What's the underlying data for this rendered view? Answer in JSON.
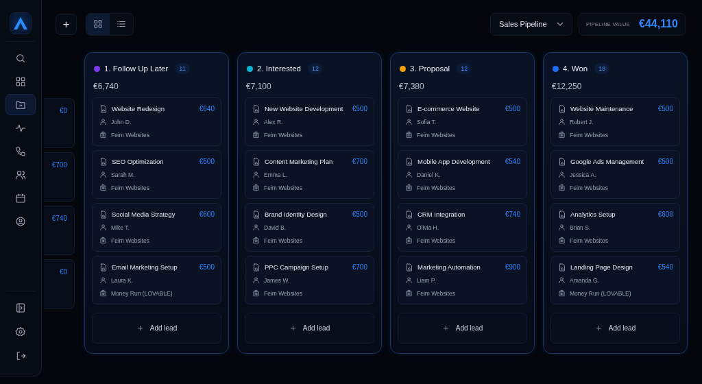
{
  "sidebar": {
    "nav": [
      {
        "selected": false
      },
      {
        "selected": false
      },
      {
        "selected": true
      },
      {
        "selected": false
      },
      {
        "selected": false
      },
      {
        "selected": false
      },
      {
        "selected": false
      },
      {
        "selected": false
      }
    ],
    "footer": [
      {
        "selected": false
      },
      {
        "selected": false
      },
      {
        "selected": false
      }
    ]
  },
  "toolbar": {
    "add_button": "+",
    "views": [
      {
        "kind": "grid",
        "selected": true
      },
      {
        "kind": "list",
        "selected": false
      }
    ],
    "pipeline_select": "Sales Pipeline",
    "pipeline_value": {
      "label": "PIPELINE VALUE",
      "amount": "€44,110"
    }
  },
  "partial_column": {
    "amounts": [
      "€0",
      "€700",
      "€740",
      "€0"
    ]
  },
  "columns": [
    {
      "name": "1. Follow Up Later",
      "color": "#7c3aed",
      "count": "11",
      "total": "€6,740",
      "add_label": "Add lead",
      "leads": [
        {
          "title": "Website Redesign",
          "amount": "€640",
          "contact": "John D.",
          "company": "Feim Websites"
        },
        {
          "title": "SEO Optimization",
          "amount": "€500",
          "contact": "Sarah M.",
          "company": "Feim Websites"
        },
        {
          "title": "Social Media Strategy",
          "amount": "€600",
          "contact": "Mike T.",
          "company": "Feim Websites"
        },
        {
          "title": "Email Marketing Setup",
          "amount": "€500",
          "contact": "Laura K.",
          "company": "Money Run (LOVABLE)"
        }
      ]
    },
    {
      "name": "2. Interested",
      "color": "#06b6d4",
      "count": "12",
      "total": "€7,100",
      "add_label": "Add lead",
      "leads": [
        {
          "title": "New Website Development",
          "amount": "€500",
          "contact": "Alex R.",
          "company": "Feim Websites"
        },
        {
          "title": "Content Marketing Plan",
          "amount": "€700",
          "contact": "Emma L.",
          "company": "Feim Websites"
        },
        {
          "title": "Brand Identity Design",
          "amount": "€500",
          "contact": "David B.",
          "company": "Feim Websites"
        },
        {
          "title": "PPC Campaign Setup",
          "amount": "€700",
          "contact": "James W.",
          "company": "Feim Websites"
        }
      ]
    },
    {
      "name": "3. Proposal",
      "color": "#f59e0b",
      "count": "12",
      "total": "€7,380",
      "add_label": "Add lead",
      "leads": [
        {
          "title": "E-commerce Website",
          "amount": "€500",
          "contact": "Sofia T.",
          "company": "Feim Websites"
        },
        {
          "title": "Mobile App Development",
          "amount": "€540",
          "contact": "Daniel K.",
          "company": "Feim Websites"
        },
        {
          "title": "CRM Integration",
          "amount": "€740",
          "contact": "Olivia H.",
          "company": "Feim Websites"
        },
        {
          "title": "Marketing Automation",
          "amount": "€900",
          "contact": "Liam P.",
          "company": "Feim Websites"
        }
      ]
    },
    {
      "name": "4. Won",
      "color": "#1d6ff2",
      "count": "18",
      "total": "€12,250",
      "add_label": "Add lead",
      "leads": [
        {
          "title": "Website Maintenance",
          "amount": "€500",
          "contact": "Robert J.",
          "company": "Feim Websites"
        },
        {
          "title": "Google Ads Management",
          "amount": "€500",
          "contact": "Jessica A.",
          "company": "Feim Websites"
        },
        {
          "title": "Analytics Setup",
          "amount": "€600",
          "contact": "Brian S.",
          "company": "Feim Websites"
        },
        {
          "title": "Landing Page Design",
          "amount": "€540",
          "contact": "Amanda G.",
          "company": "Money Run (LOVABLE)"
        }
      ]
    }
  ]
}
